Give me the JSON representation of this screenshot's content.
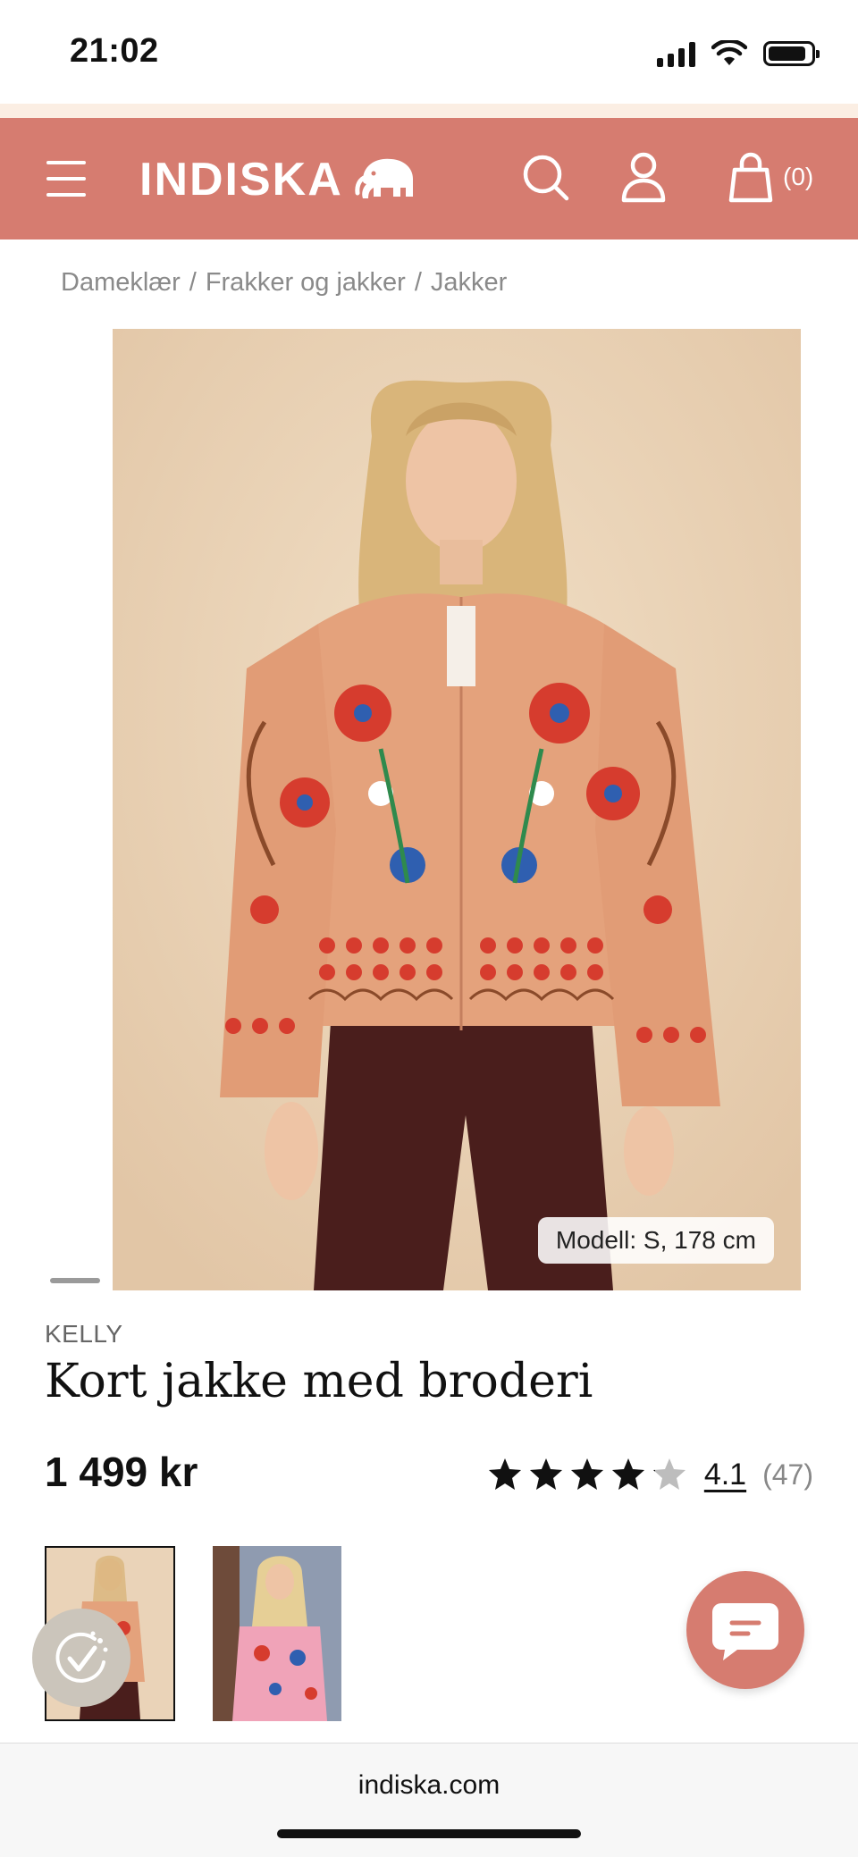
{
  "status_bar": {
    "time": "21:02",
    "battery_level": 0.9
  },
  "header": {
    "logo_text": "INDISKA",
    "cart_count": "(0)",
    "background_color": "#d67c70",
    "icons": [
      "menu-icon",
      "elephant-logo-icon",
      "search-icon",
      "user-icon",
      "bag-icon"
    ]
  },
  "breadcrumb": [
    "Dameklær",
    "Frakker og jakker",
    "Jakker"
  ],
  "product": {
    "image_badge": "Modell: S, 178 cm",
    "brand": "KELLY",
    "title": "Kort jakke med broderi",
    "price": "1 499 kr",
    "rating_value": "4.1",
    "rating_count": "(47)",
    "rating_stars": 4.1,
    "rating_max": 5
  },
  "browser": {
    "url": "indiska.com"
  }
}
